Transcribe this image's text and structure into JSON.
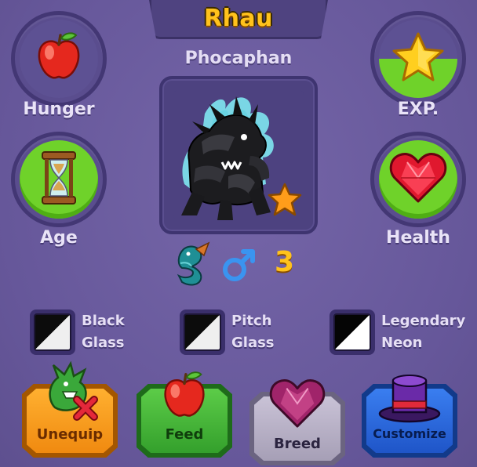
{
  "pet": {
    "name": "Rhau",
    "species": "Phocaphan",
    "level": "3",
    "gender_icon": "male-symbol-icon",
    "element_icon": "water-dragon-icon"
  },
  "stats": {
    "hunger": {
      "label": "Hunger",
      "icon": "apple-icon",
      "fill": 0.0
    },
    "exp": {
      "label": "EXP.",
      "icon": "star-icon",
      "fill": 0.5
    },
    "age": {
      "label": "Age",
      "icon": "hourglass-icon",
      "fill": 1.0
    },
    "health": {
      "label": "Health",
      "icon": "heart-icon",
      "fill": 1.0
    }
  },
  "genes": [
    {
      "line1": "Black",
      "line2": "Glass"
    },
    {
      "line1": "Pitch",
      "line2": "Glass"
    },
    {
      "line1": "Legendary",
      "line2": "Neon"
    }
  ],
  "buttons": {
    "unequip": "Unequip",
    "feed": "Feed",
    "breed": "Breed",
    "customize": "Customize"
  },
  "colors": {
    "background": "#6a5a9a",
    "name_gold": "#ffc21c",
    "stat_green": "#6fd22a",
    "unequip_orange": "#f39a1a",
    "feed_green": "#3fb43a",
    "breed_gray": "#b6aec6",
    "customize_blue": "#2a63d6"
  }
}
